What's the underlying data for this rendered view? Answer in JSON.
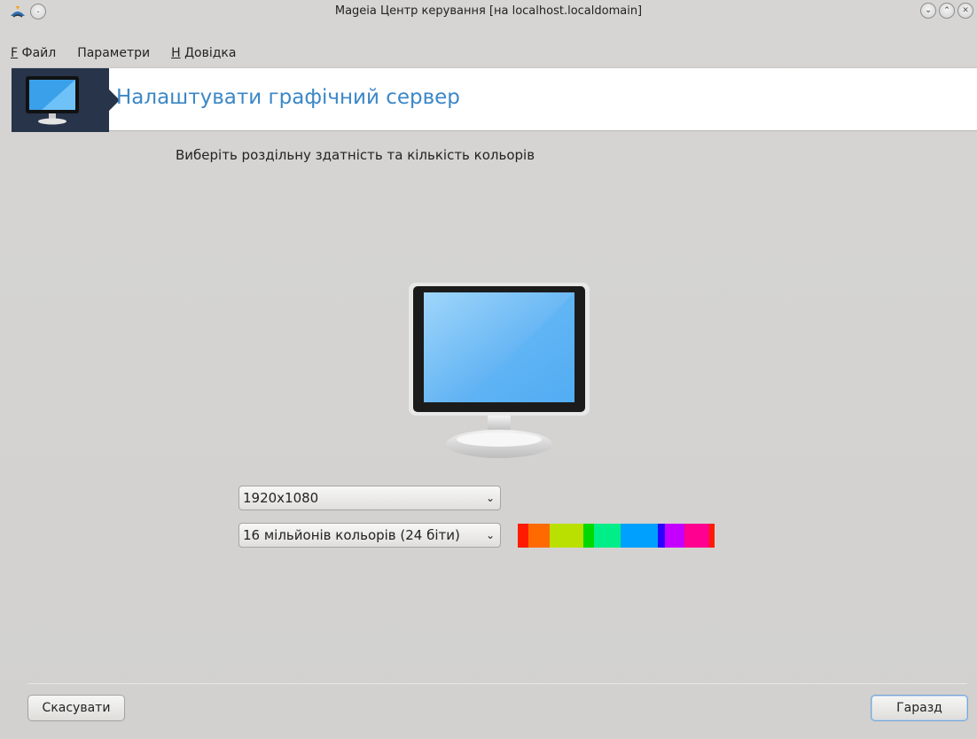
{
  "window": {
    "title": "Mageia Центр керування  [на localhost.localdomain]"
  },
  "menubar": {
    "items": [
      {
        "mnemonic": "F",
        "label": " Файл"
      },
      {
        "label": "Параметри"
      },
      {
        "mnemonic": "H",
        "label": " Довідка"
      }
    ]
  },
  "banner": {
    "title": "Налаштувати графічний сервер",
    "icon": "monitor-icon"
  },
  "dialog": {
    "subtitle": "Виберіть роздільну здатність та кількість кольорів",
    "resolution": "1920x1080",
    "color_depth": "16 мільйонів кольорів (24 біти)",
    "spectrum_colors": [
      "#ff1a00",
      "#ff6a00",
      "#ff6a00",
      "#b9e000",
      "#b9e000",
      "#00d800",
      "#00ee88",
      "#00a0ff",
      "#00a0ff",
      "#2a00ff",
      "#c400ff",
      "#ff0090",
      "#ff1a00"
    ]
  },
  "buttons": {
    "cancel": "Скасувати",
    "ok": "Гаразд"
  },
  "colors": {
    "banner_accent": "#27344a",
    "title_blue": "#3b87c7"
  }
}
